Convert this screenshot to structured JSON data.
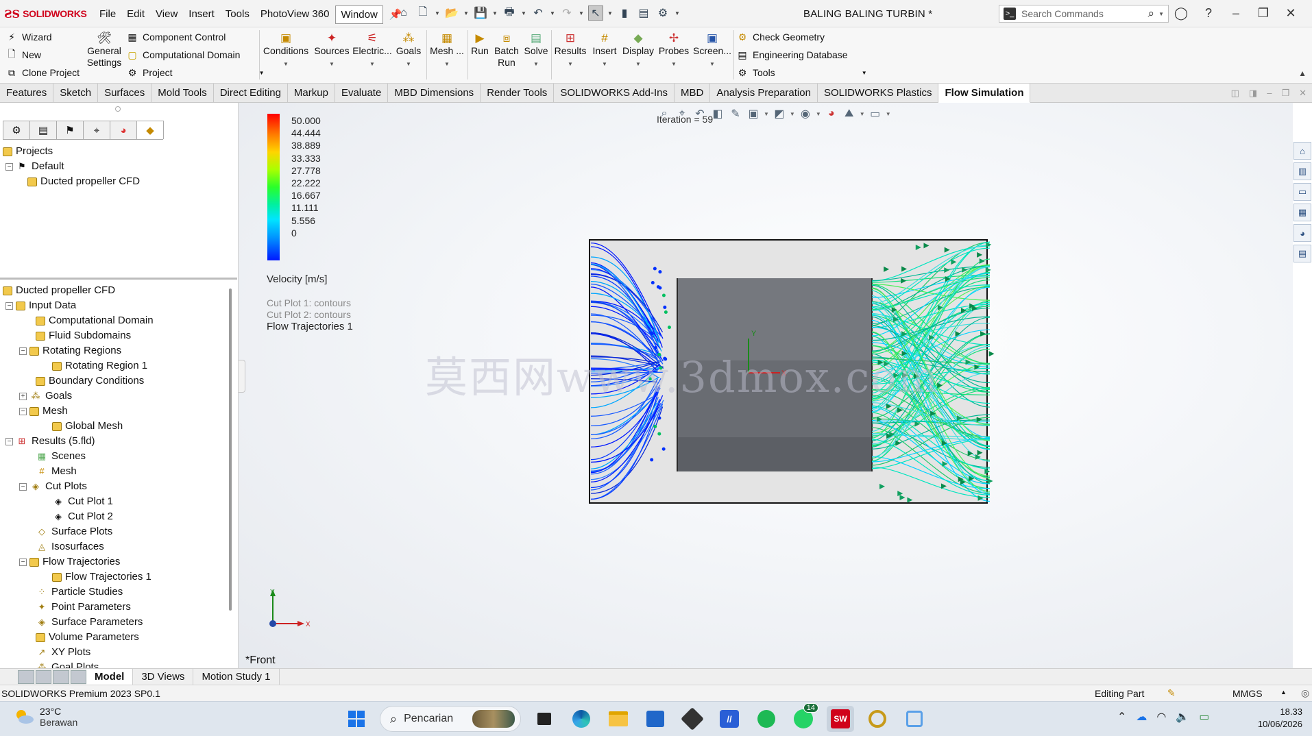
{
  "app": {
    "logo_text": "SOLIDWORKS",
    "document_title": "BALING BALING TURBIN *",
    "menu": [
      "File",
      "Edit",
      "View",
      "Insert",
      "Tools",
      "PhotoView 360",
      "Window"
    ],
    "search_placeholder": "Search Commands"
  },
  "ribbon": {
    "project_group": [
      "Wizard",
      "New",
      "Clone Project"
    ],
    "general_settings": "General Settings",
    "domain_group": [
      "Component Control",
      "Computational Domain",
      "Project"
    ],
    "conditions": "Conditions",
    "sources": "Sources",
    "electric": "Electric...",
    "goals": "Goals",
    "mesh": "Mesh ...",
    "run": "Run",
    "batch_run": "Batch Run",
    "solve": "Solve",
    "results": "Results",
    "insert": "Insert",
    "display": "Display",
    "probes": "Probes",
    "screen": "Screen...",
    "tools_group": [
      "Check Geometry",
      "Engineering Database",
      "Tools"
    ]
  },
  "tabs": [
    "Features",
    "Sketch",
    "Surfaces",
    "Mold Tools",
    "Direct Editing",
    "Markup",
    "Evaluate",
    "MBD Dimensions",
    "Render Tools",
    "SOLIDWORKS Add-Ins",
    "MBD",
    "Analysis Preparation",
    "SOLIDWORKS Plastics",
    "Flow Simulation"
  ],
  "active_tab": "Flow Simulation",
  "projects_tree": {
    "root": "Projects",
    "default": "Default",
    "project": "Ducted propeller CFD"
  },
  "analysis_tree": {
    "root": "Ducted propeller CFD",
    "input_data": "Input Data",
    "computational_domain": "Computational Domain",
    "fluid_subdomains": "Fluid Subdomains",
    "rotating_regions": "Rotating Regions",
    "rotating_region_1": "Rotating Region 1",
    "boundary_conditions": "Boundary Conditions",
    "goals": "Goals",
    "mesh": "Mesh",
    "global_mesh": "Global Mesh",
    "results": "Results (5.fld)",
    "scenes": "Scenes",
    "results_mesh": "Mesh",
    "cut_plots": "Cut Plots",
    "cut_plot_1": "Cut Plot 1",
    "cut_plot_2": "Cut Plot 2",
    "surface_plots": "Surface Plots",
    "isosurfaces": "Isosurfaces",
    "flow_trajectories": "Flow Trajectories",
    "flow_trajectories_1": "Flow Trajectories 1",
    "particle_studies": "Particle Studies",
    "point_parameters": "Point Parameters",
    "surface_parameters": "Surface Parameters",
    "volume_parameters": "Volume Parameters",
    "xy_plots": "XY Plots",
    "goal_plots": "Goal Plots"
  },
  "viewport": {
    "legend_values": [
      "50.000",
      "44.444",
      "38.889",
      "33.333",
      "27.778",
      "22.222",
      "16.667",
      "11.111",
      "5.556",
      "0"
    ],
    "legend_title": "Velocity [m/s]",
    "feature_list": [
      "Cut Plot 1: contours",
      "Cut Plot 2: contours",
      "Flow Trajectories 1"
    ],
    "iteration": "Iteration = 59",
    "watermark": "莫西网www.3dmox.com",
    "view_name": "*Front",
    "axis_x": "X",
    "axis_y": "Y"
  },
  "bottom_tabs": [
    "Model",
    "3D Views",
    "Motion Study 1"
  ],
  "status": {
    "product": "SOLIDWORKS Premium 2023 SP0.1",
    "mode": "Editing Part",
    "units": "MMGS"
  },
  "taskbar": {
    "temperature": "23°C",
    "weather": "Berawan",
    "search": "Pencarian",
    "whatsapp_badge": "14",
    "time": "18.33",
    "date": "10/06/2026"
  },
  "colors": {
    "brand_red": "#d0021b",
    "active_tab_bg": "#ffffff",
    "duct": "#e3e3e3",
    "hub": "#6b6e74"
  }
}
